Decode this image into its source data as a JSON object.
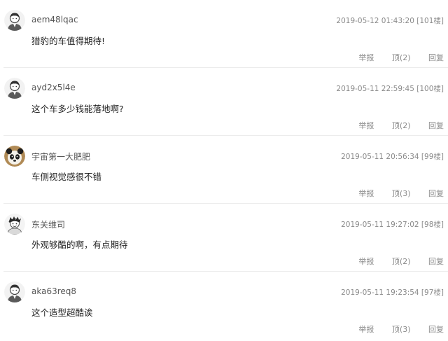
{
  "comments": [
    {
      "avatar_icon": "default-user-avatar-icon",
      "username": "aem48lqac",
      "meta": "2019-05-12 01:43:20 [101楼]",
      "content": "猎豹的车值得期待!",
      "report_label": "举报",
      "upvote_label": "顶(2)",
      "reply_label": "回复"
    },
    {
      "avatar_icon": "default-user-avatar-icon",
      "username": "ayd2x5l4e",
      "meta": "2019-05-11 22:59:45 [100楼]",
      "content": "这个车多少钱能落地啊?",
      "report_label": "举报",
      "upvote_label": "顶(2)",
      "reply_label": "回复"
    },
    {
      "avatar_icon": "panda-avatar-icon",
      "username": "宇宙第一大肥肥",
      "meta": "2019-05-11 20:56:34 [99楼]",
      "content": "车侧视觉感很不错",
      "report_label": "举报",
      "upvote_label": "顶(3)",
      "reply_label": "回复"
    },
    {
      "avatar_icon": "cartoon-avatar-icon",
      "username": "东关维司",
      "meta": "2019-05-11 19:27:02 [98楼]",
      "content": "外观够酷的啊，有点期待",
      "report_label": "举报",
      "upvote_label": "顶(2)",
      "reply_label": "回复"
    },
    {
      "avatar_icon": "default-user-avatar-icon",
      "username": "aka63req8",
      "meta": "2019-05-11 19:23:54 [97楼]",
      "content": "这个造型超酷诶",
      "report_label": "举报",
      "upvote_label": "顶(3)",
      "reply_label": "回复"
    }
  ]
}
